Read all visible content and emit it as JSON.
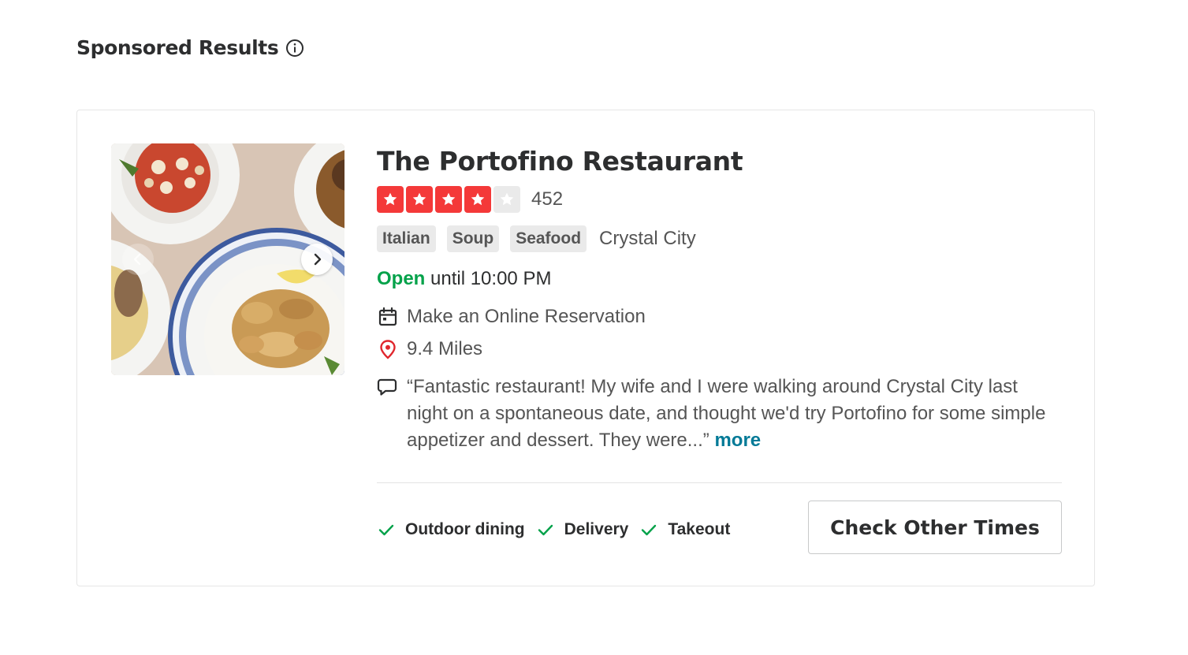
{
  "section": {
    "title": "Sponsored Results",
    "info_icon": "info-circle-icon"
  },
  "business": {
    "name": "The Portofino Restaurant",
    "rating": 4,
    "max_rating": 5,
    "review_count": "452",
    "categories": [
      "Italian",
      "Soup",
      "Seafood"
    ],
    "neighborhood": "Crystal City",
    "hours": {
      "status": "Open",
      "detail": "until 10:00 PM"
    },
    "reservation": {
      "icon": "calendar-icon",
      "label": "Make an Online Reservation"
    },
    "distance": {
      "icon": "map-pin-icon",
      "label": "9.4 Miles"
    },
    "snippet": {
      "icon": "speech-bubble-icon",
      "text": "“Fantastic restaurant! My wife and I were walking around Crystal City last night on a spontaneous date, and thought we'd try Portofino for some simple appetizer and dessert. They were...”",
      "more_label": "more"
    },
    "amenities": [
      {
        "label": "Outdoor dining",
        "icon": "check-icon"
      },
      {
        "label": "Delivery",
        "icon": "check-icon"
      },
      {
        "label": "Takeout",
        "icon": "check-icon"
      }
    ],
    "cta_label": "Check Other Times"
  },
  "colors": {
    "star_red": "#f43939",
    "open_green": "#04a24a",
    "link_teal": "#027a97",
    "pin_red": "#e0262d"
  }
}
